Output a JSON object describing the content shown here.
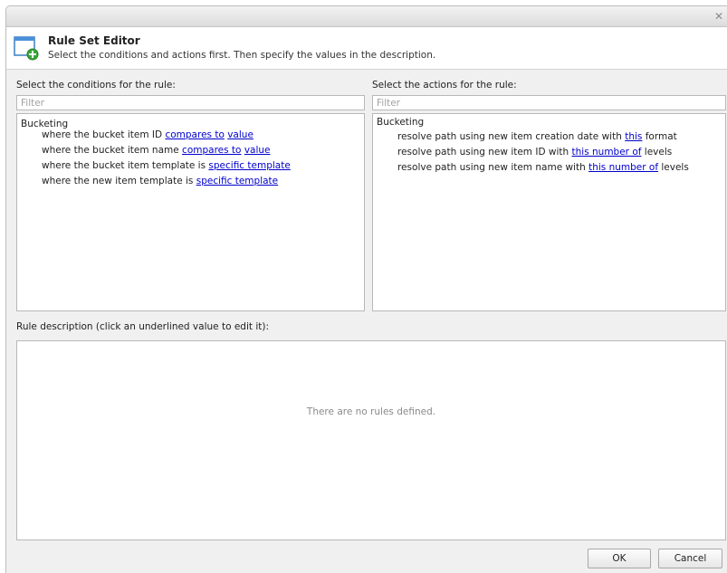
{
  "header": {
    "title": "Rule Set Editor",
    "subtitle": "Select the conditions and actions first. Then specify the values in the description."
  },
  "conditions": {
    "label": "Select the conditions for the rule:",
    "filter_placeholder": "Filter",
    "group": "Bucketing",
    "items": [
      {
        "parts": [
          "where the bucket item ID ",
          "compares to",
          " ",
          "value",
          ""
        ]
      },
      {
        "parts": [
          "where the bucket item name ",
          "compares to",
          " ",
          "value",
          ""
        ]
      },
      {
        "parts": [
          "where the bucket item template is ",
          "specific template",
          ""
        ]
      },
      {
        "parts": [
          "where the new item template is ",
          "specific template",
          ""
        ]
      }
    ]
  },
  "actions": {
    "label": "Select the actions for the rule:",
    "filter_placeholder": "Filter",
    "group": "Bucketing",
    "items": [
      {
        "parts": [
          "resolve path using new item creation date with ",
          "this",
          " format"
        ]
      },
      {
        "parts": [
          "resolve path using new item ID with ",
          "this number of",
          " levels"
        ]
      },
      {
        "parts": [
          "resolve path using new item name with ",
          "this number of",
          " levels"
        ]
      }
    ]
  },
  "description": {
    "label": "Rule description (click an underlined value to edit it):",
    "empty_message": "There are no rules defined."
  },
  "buttons": {
    "ok": "OK",
    "cancel": "Cancel"
  },
  "close_glyph": "✕"
}
